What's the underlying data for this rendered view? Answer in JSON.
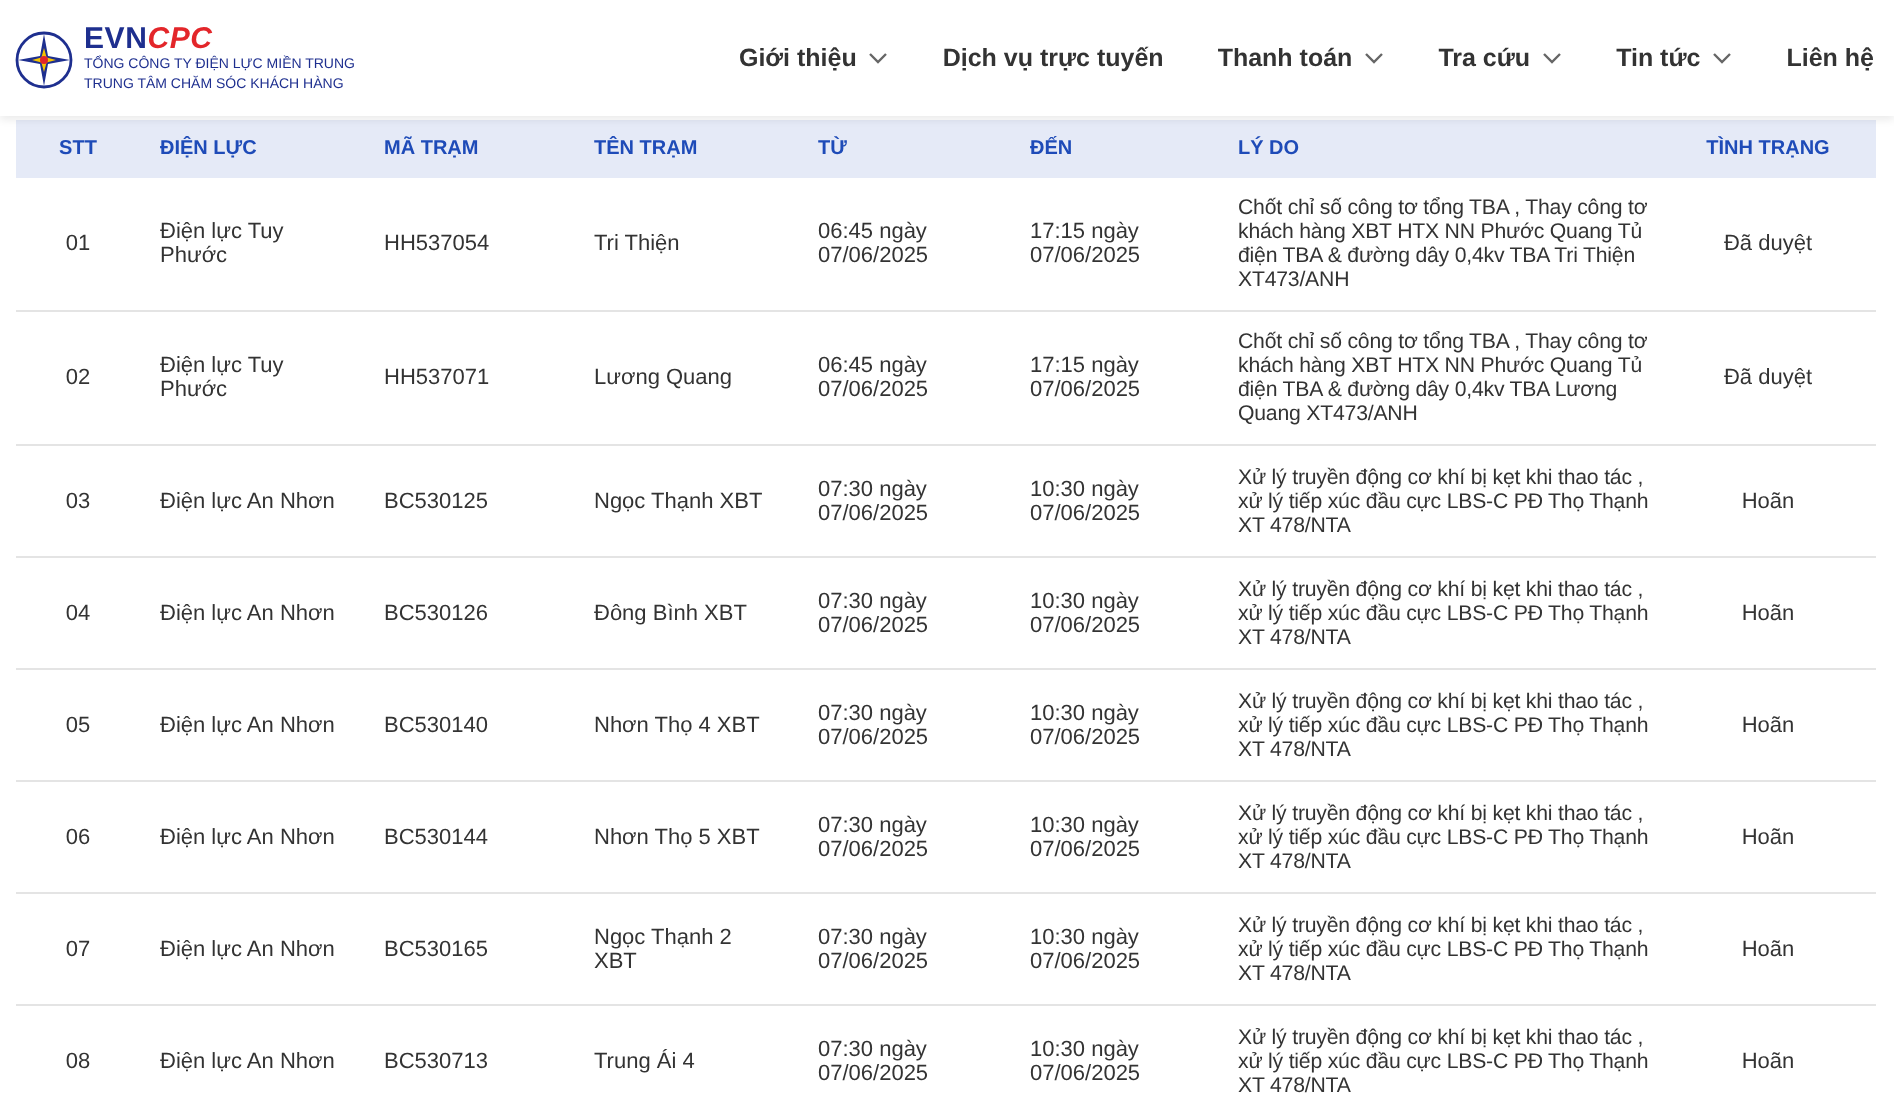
{
  "logo": {
    "brand_main": "EVN",
    "brand_accent": "CPC",
    "line1": "TỔNG CÔNG TY ĐIỆN LỰC MIỀN TRUNG",
    "line2": "TRUNG TÂM CHĂM SÓC KHÁCH HÀNG"
  },
  "nav": [
    {
      "label": "Giới thiệu",
      "dropdown": true
    },
    {
      "label": "Dịch vụ trực tuyến",
      "dropdown": false
    },
    {
      "label": "Thanh toán",
      "dropdown": true
    },
    {
      "label": "Tra cứu",
      "dropdown": true
    },
    {
      "label": "Tin tức",
      "dropdown": true
    },
    {
      "label": "Liên hệ",
      "dropdown": false
    }
  ],
  "table": {
    "columns": [
      "STT",
      "ĐIỆN LỰC",
      "MÃ TRẠM",
      "TÊN TRẠM",
      "TỪ",
      "ĐẾN",
      "LÝ DO",
      "TÌNH TRẠNG"
    ],
    "rows": [
      [
        "01",
        "Điện lực Tuy Phước",
        "HH537054",
        "Tri Thiện",
        "06:45 ngày 07/06/2025",
        "17:15 ngày 07/06/2025",
        "Chốt chỉ số công tơ tổng TBA , Thay công tơ khách hàng XBT HTX NN Phước Quang Tủ điện TBA & đường dây 0,4kv TBA Tri Thiện XT473/ANH",
        "Đã duyệt"
      ],
      [
        "02",
        "Điện lực Tuy Phước",
        "HH537071",
        "Lương Quang",
        "06:45 ngày 07/06/2025",
        "17:15 ngày 07/06/2025",
        "Chốt chỉ số công tơ tổng TBA , Thay công tơ khách hàng XBT HTX NN Phước Quang Tủ điện TBA & đường dây 0,4kv TBA Lương Quang XT473/ANH",
        "Đã duyệt"
      ],
      [
        "03",
        "Điện lực An Nhơn",
        "BC530125",
        "Ngọc Thạnh XBT",
        "07:30 ngày 07/06/2025",
        "10:30 ngày 07/06/2025",
        "Xử lý truyền động cơ khí bị kẹt khi thao tác , xử lý tiếp xúc đầu cực LBS-C PĐ Thọ Thạnh XT 478/NTA",
        "Hoãn"
      ],
      [
        "04",
        "Điện lực An Nhơn",
        "BC530126",
        "Đông Bình XBT",
        "07:30 ngày 07/06/2025",
        "10:30 ngày 07/06/2025",
        "Xử lý truyền động cơ khí bị kẹt khi thao tác , xử lý tiếp xúc đầu cực LBS-C PĐ Thọ Thạnh XT 478/NTA",
        "Hoãn"
      ],
      [
        "05",
        "Điện lực An Nhơn",
        "BC530140",
        "Nhơn Thọ 4 XBT",
        "07:30 ngày 07/06/2025",
        "10:30 ngày 07/06/2025",
        "Xử lý truyền động cơ khí bị kẹt khi thao tác , xử lý tiếp xúc đầu cực LBS-C PĐ Thọ Thạnh XT 478/NTA",
        "Hoãn"
      ],
      [
        "06",
        "Điện lực An Nhơn",
        "BC530144",
        "Nhơn Thọ 5 XBT",
        "07:30 ngày 07/06/2025",
        "10:30 ngày 07/06/2025",
        "Xử lý truyền động cơ khí bị kẹt khi thao tác , xử lý tiếp xúc đầu cực LBS-C PĐ Thọ Thạnh XT 478/NTA",
        "Hoãn"
      ],
      [
        "07",
        "Điện lực An Nhơn",
        "BC530165",
        "Ngọc Thạnh 2 XBT",
        "07:30 ngày 07/06/2025",
        "10:30 ngày 07/06/2025",
        "Xử lý truyền động cơ khí bị kẹt khi thao tác , xử lý tiếp xúc đầu cực LBS-C PĐ Thọ Thạnh XT 478/NTA",
        "Hoãn"
      ],
      [
        "08",
        "Điện lực An Nhơn",
        "BC530713",
        "Trung Ái 4",
        "07:30 ngày 07/06/2025",
        "10:30 ngày 07/06/2025",
        "Xử lý truyền động cơ khí bị kẹt khi thao tác , xử lý tiếp xúc đầu cực LBS-C PĐ Thọ Thạnh XT 478/NTA",
        "Hoãn"
      ]
    ]
  }
}
